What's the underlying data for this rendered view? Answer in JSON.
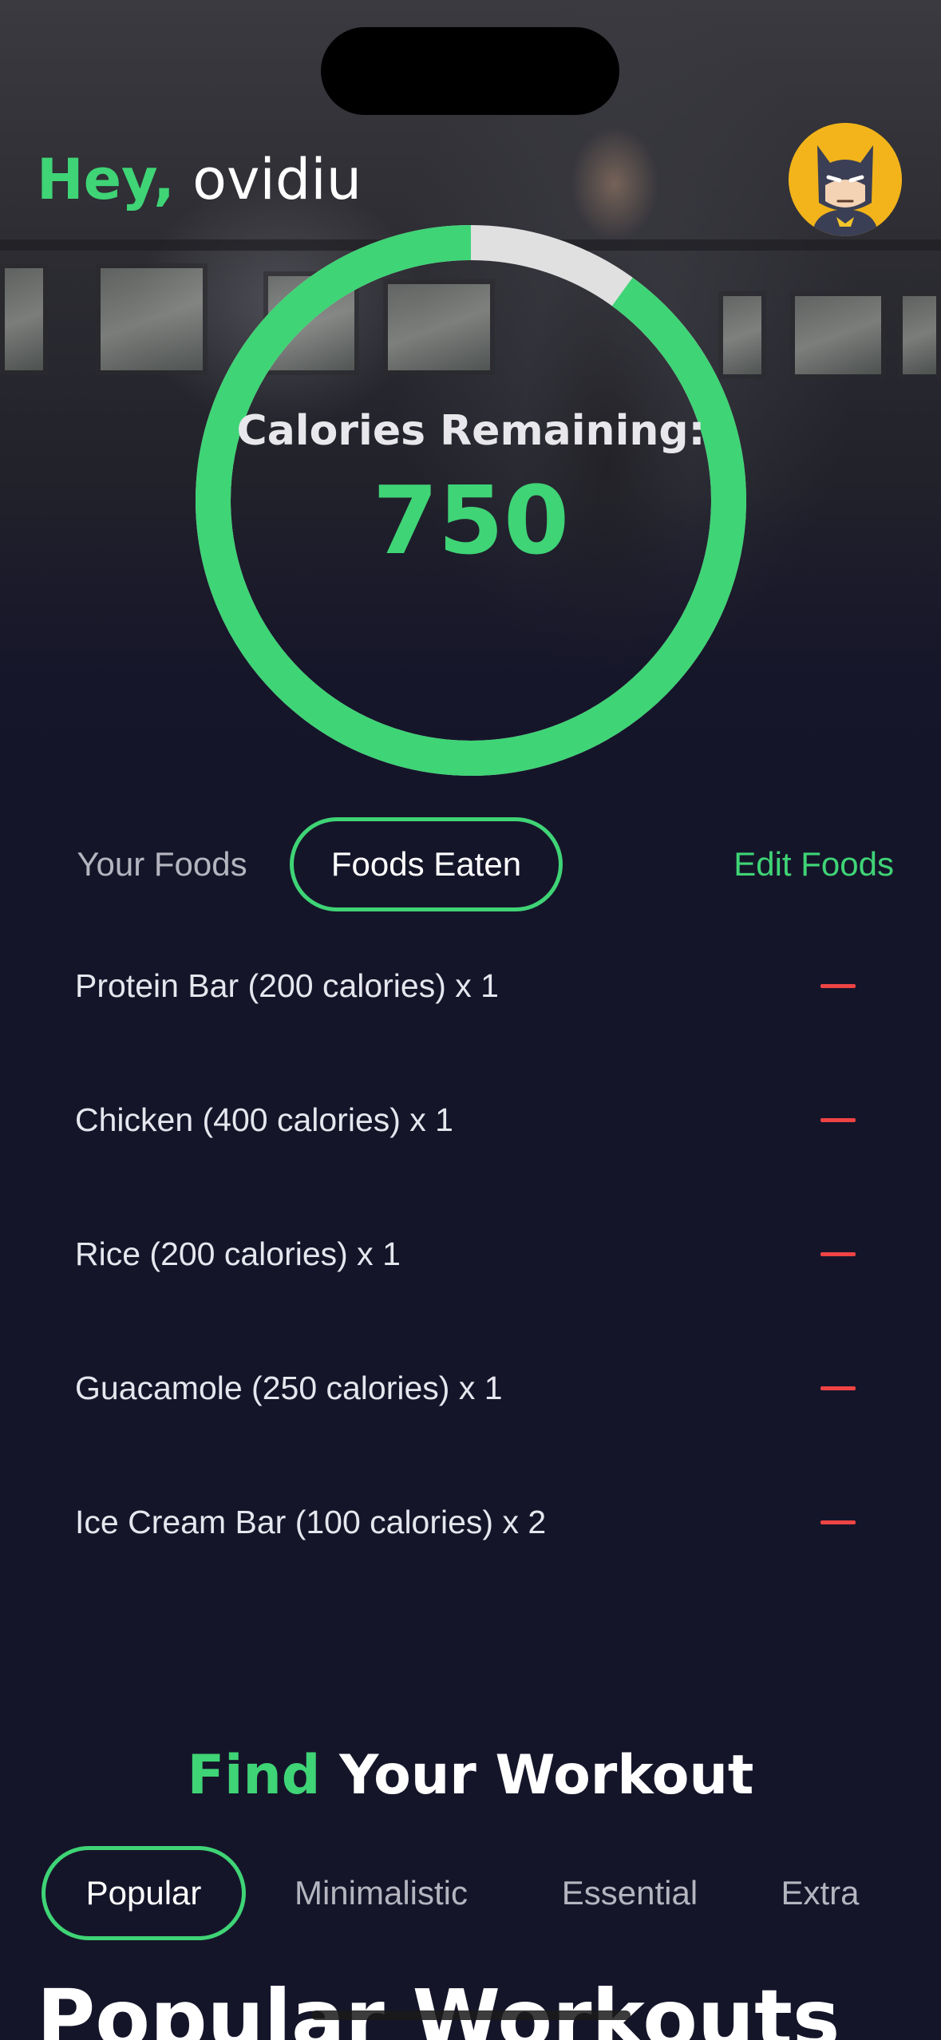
{
  "greeting": {
    "prefix": "Hey,",
    "name": "ovidiu"
  },
  "avatar": {
    "icon": "batman-avatar-icon",
    "bg_color": "#f2b41a"
  },
  "calories": {
    "label": "Calories Remaining:",
    "value": "750",
    "ring_progress": 0.9
  },
  "food_tabs": {
    "items": [
      "Your Foods",
      "Foods Eaten"
    ],
    "selected": "Foods Eaten",
    "edit_label": "Edit Foods"
  },
  "foods_eaten": [
    {
      "text": "Protein Bar (200 calories) x 1",
      "remove_icon": "minus-icon"
    },
    {
      "text": "Chicken (400 calories) x 1",
      "remove_icon": "minus-icon"
    },
    {
      "text": "Rice (200 calories) x 1",
      "remove_icon": "minus-icon"
    },
    {
      "text": "Guacamole (250 calories) x 1",
      "remove_icon": "minus-icon"
    },
    {
      "text": "Ice Cream Bar (100 calories) x 2",
      "remove_icon": "minus-icon"
    }
  ],
  "workout_section": {
    "title_accent": "Find",
    "title_rest": "Your Workout",
    "tabs": [
      "Popular",
      "Minimalistic",
      "Essential",
      "Extra"
    ],
    "selected": "Popular",
    "heading": "Popular Workouts"
  },
  "colors": {
    "accent": "#3fd476",
    "background": "#15152a",
    "remove": "#ee4444",
    "ring_track": "#e0e0e0"
  }
}
